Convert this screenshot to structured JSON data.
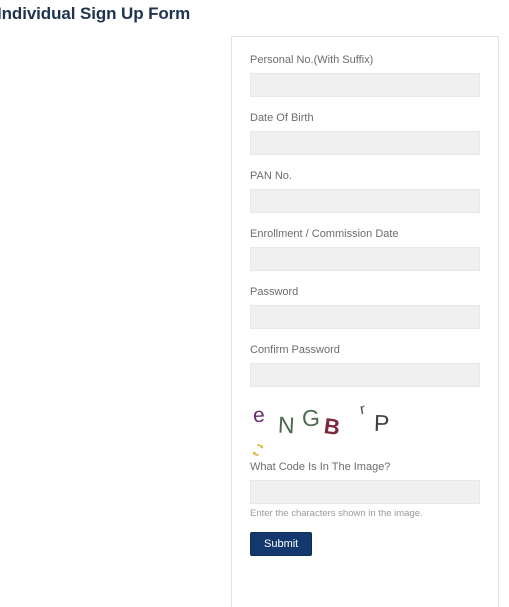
{
  "page": {
    "title": "Individual Sign Up Form"
  },
  "form": {
    "fields": [
      {
        "label": "Personal No.(With Suffix)",
        "value": "",
        "placeholder": ""
      },
      {
        "label": "Date Of Birth",
        "value": "",
        "placeholder": ""
      },
      {
        "label": "PAN No.",
        "value": "",
        "placeholder": ""
      },
      {
        "label": "Enrollment / Commission Date",
        "value": "",
        "placeholder": ""
      },
      {
        "label": "Password",
        "value": "",
        "placeholder": ""
      },
      {
        "label": "Confirm Password",
        "value": "",
        "placeholder": ""
      }
    ],
    "captcha": {
      "characters": [
        {
          "char": "e",
          "color": "#6b2f6b"
        },
        {
          "char": "N",
          "color": "#4a6b4a"
        },
        {
          "char": "G",
          "color": "#4e6a50"
        },
        {
          "char": "B",
          "color": "#7d2b3a"
        },
        {
          "char": "r",
          "color": "#4a4a58"
        },
        {
          "char": "P",
          "color": "#3f3f46"
        }
      ],
      "code_text": "eNGBrP",
      "refresh_icon": "refresh-icon",
      "refresh_color": "#e0b84a",
      "label": "What Code Is In The Image?",
      "value": "",
      "placeholder": "",
      "helper": "Enter the characters shown in the image."
    },
    "submit_label": "Submit",
    "submit_color": "#12386e"
  }
}
